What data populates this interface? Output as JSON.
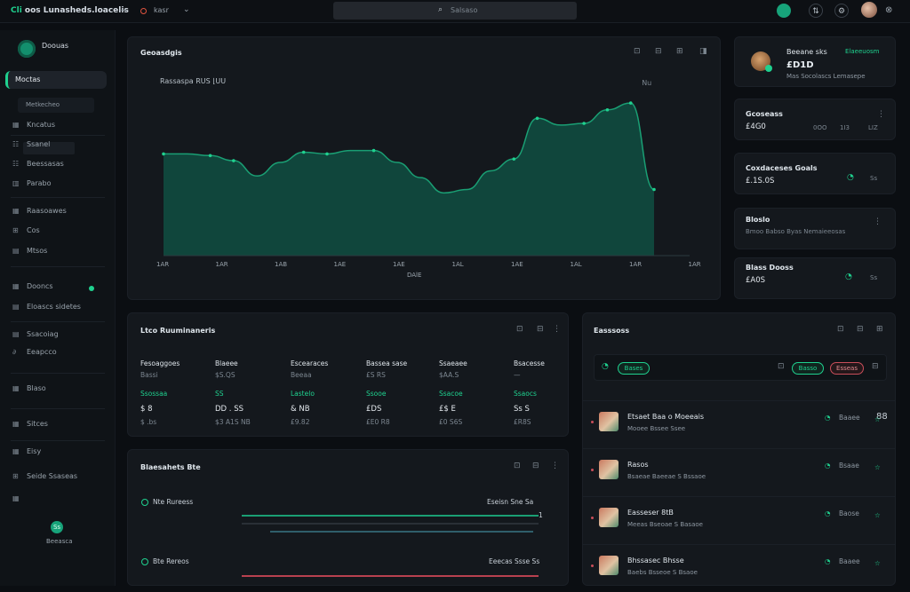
{
  "topbar": {
    "app_prefix": "Cli",
    "title": "oos Lunasheds.loacelis",
    "arrow": "↔",
    "selector": "kasr",
    "search_placeholder": "Salsaso",
    "avatar_icon": "user-avatar"
  },
  "sidebar": {
    "app_name": "Doouas",
    "active_item": "Moctas",
    "sub_item": "Metkecheo",
    "items": [
      {
        "icon": "▦",
        "label": "Kncatus"
      },
      {
        "icon": "☷",
        "label": "Ssanel"
      },
      {
        "icon": "☷",
        "label": "Beessasas"
      },
      {
        "icon": "▥",
        "label": "Parabo"
      },
      {
        "icon": "▦",
        "label": "Raasoawes"
      },
      {
        "icon": "⊞",
        "label": "Cos"
      },
      {
        "icon": "▤",
        "label": "Mtsos"
      },
      {
        "icon": "▦",
        "label": "Dooncs"
      },
      {
        "icon": "▤",
        "label": "Eloascs sidetes"
      },
      {
        "icon": "▤",
        "label": "Ssacoiag"
      },
      {
        "icon": "∂",
        "label": "Eeapcco"
      },
      {
        "icon": "▦",
        "label": "Blaso"
      },
      {
        "icon": "▦",
        "label": "Sitces"
      },
      {
        "icon": "▦",
        "label": "Eisy"
      },
      {
        "icon": "⊞",
        "label": "Seide Ssaseas"
      },
      {
        "icon": "▦",
        "label": ""
      }
    ],
    "badge_count": "●",
    "bottom_icon_label": "Ss",
    "bottom_label": "Beeasca"
  },
  "overview": {
    "title": "Geoasdgis",
    "subtitle": "Rassaspa RUS  ⌊UU",
    "legend": [
      "",
      "",
      "Nu"
    ],
    "icons": [
      "⊡",
      "⊟",
      "⊞",
      "◨"
    ],
    "xlabel": "DAlE"
  },
  "chart_data": {
    "type": "area",
    "title": "Geoasdgis",
    "subtitle": "Rassaspa RUS  ⌊UU",
    "xlabel": "DAlE",
    "ylabel": "",
    "categories": [
      "1AR",
      "1AR",
      "1AB",
      "1AE",
      "1AE",
      "1AL",
      "1AE",
      "1AL",
      "1AR",
      "1AR"
    ],
    "x": [
      0,
      1,
      2,
      3,
      4,
      5,
      6,
      7,
      8,
      9,
      10,
      11,
      12,
      13,
      14,
      15,
      16,
      17,
      18,
      19,
      20,
      21
    ],
    "values": [
      60,
      60,
      59,
      56,
      47,
      55,
      61,
      60,
      62,
      62,
      55,
      46,
      37,
      39,
      50,
      57,
      81,
      77,
      78,
      86,
      90,
      39
    ],
    "xlim": [
      0,
      21
    ],
    "ylim": [
      0,
      100
    ],
    "color": "#1a9f74",
    "fill": "#10463c",
    "grid": false
  },
  "right_stats": {
    "profile": {
      "name": "Beeane sks",
      "link": "Elaeeuosm",
      "value": "£D1D",
      "sub": "Mas Socolascs  Lemasepe"
    },
    "stat1": {
      "title": "Gcoseass",
      "value": "£4G0",
      "cols": [
        "0OO",
        "0OO",
        "1I3",
        "LIZ"
      ]
    },
    "stat2": {
      "title": "Coxdaceses Goals",
      "value": "£.1S.0S",
      "badge": "Ss"
    },
    "stat3": {
      "title": "Bloslo",
      "sub": "Bmoo Babso Byas Nemaieeosas"
    },
    "stat4": {
      "title": "Blass Dooss",
      "value": "£A0S",
      "badge": "Ss"
    }
  },
  "table": {
    "title": "Ltco Ruuminaneris",
    "headers": [
      "Fesoaggoes",
      "Blaeee",
      "Escearaces",
      "Bassea sase",
      "Ssaeaee",
      "Bsacesse"
    ],
    "row1": [
      "Bassi",
      "$S.QS",
      "Beeaa",
      "£S RS",
      "$AA.S",
      "—"
    ],
    "row2": [
      "Ssossaa",
      "SS",
      "Lastelo",
      "Ssooe",
      "Ssacoe",
      "Ssaocs"
    ],
    "row3": [
      "$ 8",
      "DD . SS",
      "& NB",
      "£DS",
      "£$ E",
      "Ss S"
    ],
    "row4": [
      "$ .bs",
      "$3 A1S  NB",
      "£9.82",
      "£E0 R8",
      "£0 S6S",
      "£R8S"
    ]
  },
  "progress": {
    "title": "Blaesahets Bte",
    "items": [
      {
        "label": "Nte Rureess",
        "value": "Eseisn Sne Sa",
        "suffix": "1",
        "percent": 100,
        "color": "green"
      },
      {
        "label": "",
        "value": "",
        "suffix": "",
        "percent": 100,
        "color": "muted"
      },
      {
        "label": "Bte Rereos",
        "value": "Eeecas Ssse Ss",
        "suffix": "",
        "percent": 100,
        "color": "red"
      }
    ]
  },
  "activity": {
    "title": "Easssoss",
    "filter_pills": [
      "Bases",
      "Basso",
      "Esseas"
    ],
    "rows": [
      {
        "title": "Etsaet Baa o Moeeais",
        "sub": "Mooee Bssee  Ssee",
        "meta": "Baaee",
        "count": "88"
      },
      {
        "title": "Rasos",
        "sub": "Bsaeae Baeeae  S Bssaoe",
        "meta": "Bsaae",
        "count": ""
      },
      {
        "title": "Easseser 8tB",
        "sub": "Meeas  Bseoae  S Basaoe",
        "meta": "Baose",
        "count": ""
      },
      {
        "title": "Bhssasec Bhsse",
        "sub": "Baebs  Bsseoe  S Bsaoe",
        "meta": "Baaee",
        "count": ""
      }
    ]
  }
}
